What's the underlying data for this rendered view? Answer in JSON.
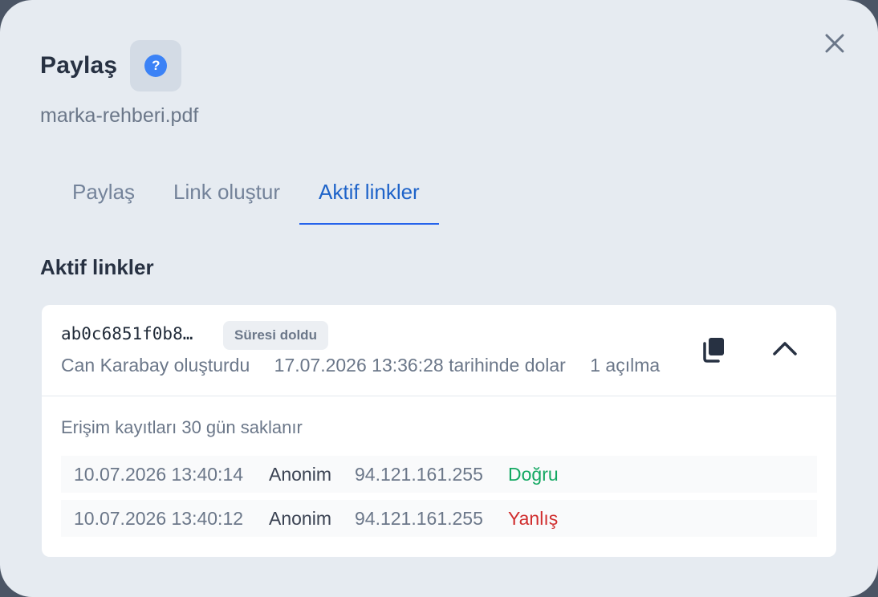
{
  "dialog": {
    "title": "Paylaş",
    "filename": "marka-rehberi.pdf",
    "help_icon": "question-circle-icon",
    "close_icon": "close-icon"
  },
  "tabs": [
    {
      "label": "Paylaş",
      "active": false
    },
    {
      "label": "Link oluştur",
      "active": false
    },
    {
      "label": "Aktif linkler",
      "active": true
    }
  ],
  "section_title": "Aktif linkler",
  "link": {
    "id": "ab0c6851f0b8…",
    "status_badge": "Süresi doldu",
    "created_by": "Can Karabay oluşturdu",
    "expires": "17.07.2026 13:36:28 tarihinde dolar",
    "opens": "1 açılma",
    "copy_icon": "copy-icon",
    "collapse_icon": "chevron-up-icon",
    "retention_note": "Erişim kayıtları 30 gün saklanır",
    "access_log": [
      {
        "timestamp": "10.07.2026 13:40:14",
        "user": "Anonim",
        "ip": "94.121.161.255",
        "result": "Doğru",
        "result_color": "#13a862"
      },
      {
        "timestamp": "10.07.2026 13:40:12",
        "user": "Anonim",
        "ip": "94.121.161.255",
        "result": "Yanlış",
        "result_color": "#d02d2d"
      }
    ]
  },
  "colors": {
    "accent": "#2563eb",
    "success": "#13a862",
    "error": "#d02d2d"
  }
}
